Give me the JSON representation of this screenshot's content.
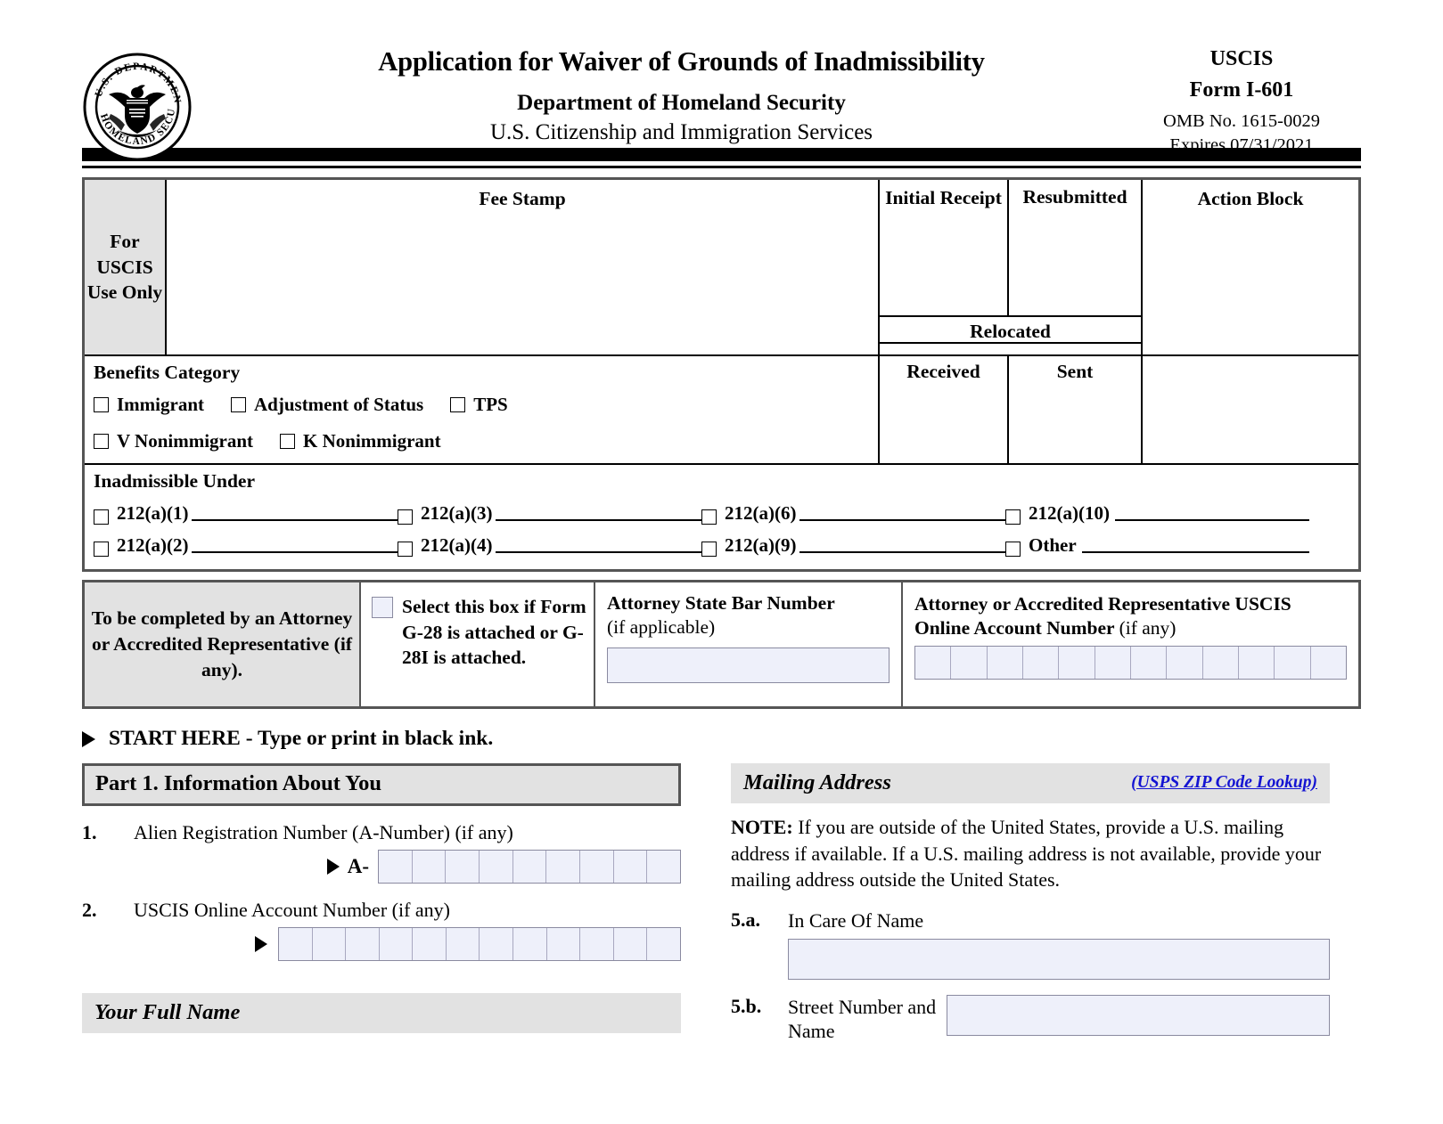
{
  "header": {
    "seal_alt": "dhs-seal",
    "title": "Application for Waiver of Grounds of Inadmissibility",
    "department": "Department of Homeland Security",
    "agency": "U.S. Citizenship and Immigration Services",
    "agency_short": "USCIS",
    "form_number": "Form I-601",
    "omb": "OMB No. 1615-0029",
    "expires": "Expires 07/31/2021"
  },
  "uscis_use": {
    "for_use_only": "For USCIS Use Only",
    "fee_stamp": "Fee Stamp",
    "initial_receipt": "Initial Receipt",
    "resubmitted": "Resubmitted",
    "relocated": "Relocated",
    "received": "Received",
    "sent": "Sent",
    "action_block": "Action Block",
    "benefits_category": "Benefits Category",
    "benefits_options_row1": [
      "Immigrant",
      "Adjustment of Status",
      "TPS"
    ],
    "benefits_options_row2": [
      "V Nonimmigrant",
      "K Nonimmigrant"
    ],
    "inadmissible_under": "Inadmissible Under",
    "inadmissible_row1": [
      "212(a)(1)",
      "212(a)(3)",
      "212(a)(6)",
      "212(a)(10)"
    ],
    "inadmissible_row2": [
      "212(a)(2)",
      "212(a)(4)",
      "212(a)(9)",
      "Other"
    ]
  },
  "attorney": {
    "to_be_completed": "To be completed by an Attorney or Accredited Representative (if any).",
    "g28_text": "Select this box if Form G-28 is attached or G-28I is attached.",
    "state_bar_label": "Attorney State Bar Number",
    "state_bar_note": "(if applicable)",
    "state_bar_value": "",
    "online_account_label": "Attorney or Accredited Representative USCIS Online Account Number",
    "online_account_note": "(if any)",
    "online_account_cells": 12
  },
  "start_here": "START HERE - Type or print in black ink.",
  "part1": {
    "heading": "Part 1.  Information About You",
    "q1": {
      "number": "1.",
      "label": "Alien Registration Number (A-Number) (if any)",
      "prefix": "A-",
      "cells": 9,
      "value": ""
    },
    "q2": {
      "number": "2.",
      "label": "USCIS Online Account Number (if any)",
      "cells": 12,
      "value": ""
    },
    "your_full_name": "Your Full Name"
  },
  "mailing_address": {
    "heading": "Mailing Address",
    "zip_lookup_link": "(USPS ZIP Code Lookup)",
    "note_label": "NOTE:",
    "note_text": "If you are outside of the United States, provide a U.S. mailing address if available.  If a U.S. mailing address is not available, provide your mailing address outside the United States.",
    "q5a": {
      "number": "5.a.",
      "label": "In Care Of Name",
      "value": ""
    },
    "q5b": {
      "number": "5.b.",
      "label": "Street Number and Name",
      "value": ""
    }
  },
  "colors": {
    "field_fill": "#eef0fa",
    "field_border": "#8a8aa0",
    "section_gray": "#e2e2e2",
    "link_blue": "#1414d2"
  }
}
